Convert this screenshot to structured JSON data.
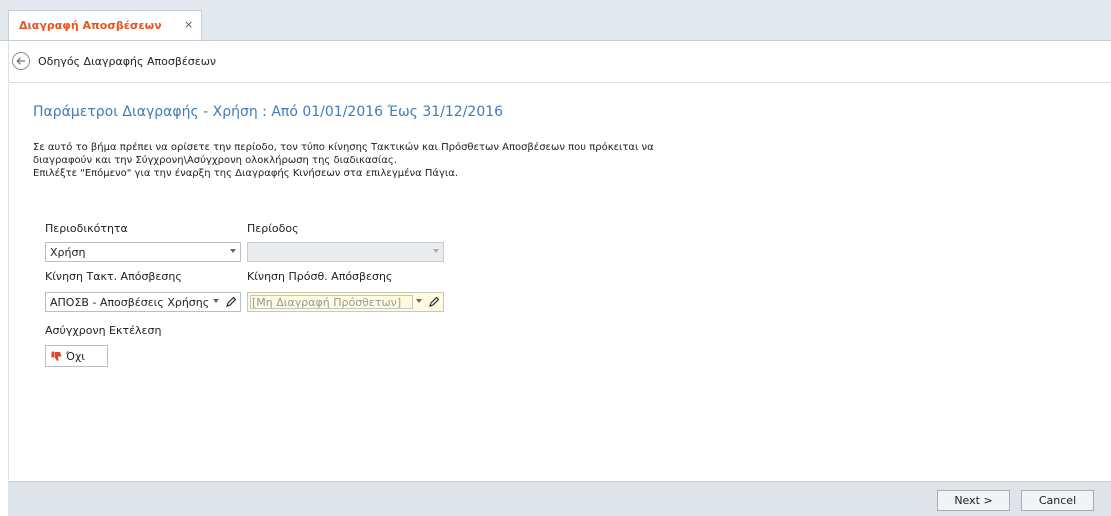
{
  "tab": {
    "label": "Διαγραφή Αποσβέσεων",
    "close": "×"
  },
  "wizard": {
    "title": "Οδηγός Διαγραφής Αποσβέσεων"
  },
  "page": {
    "title": "Παράμετροι Διαγραφής - Χρήση : Από 01/01/2016 Έως 31/12/2016",
    "description": [
      "Σε αυτό το βήμα πρέπει να ορίσετε την περίοδο, τον τύπο κίνησης Τακτικών και Πρόσθετων Αποσβέσεων που πρόκειται να",
      "διαγραφούν και την Σύγχρονη\\Ασύγχρονη ολοκλήρωση της διαδικασίας.",
      "Επιλέξτε \"Επόμενο\" για την έναρξη της Διαγραφής Κινήσεων στα επιλεγμένα Πάγια."
    ]
  },
  "form": {
    "periodicity": {
      "label": "Περιοδικότητα",
      "value": "Χρήση"
    },
    "period": {
      "label": "Περίοδος",
      "value": ""
    },
    "regular_movement": {
      "label": "Κίνηση Τακτ. Απόσβεσης",
      "value": "ΑΠΟΣΒ - Αποσβέσεις Χρήσης"
    },
    "additional_movement": {
      "label": "Κίνηση Πρόσθ. Απόσβεσης",
      "value": "[Μη Διαγραφή Πρόσθετων]"
    },
    "async": {
      "label": "Ασύγχρονη Εκτέλεση",
      "value": "Όχι"
    }
  },
  "footer": {
    "next": "Next >",
    "cancel": "Cancel"
  },
  "colors": {
    "accent_tab": "#e8541d",
    "title_blue": "#3f7cb8",
    "yellow_field": "#fffbe0"
  }
}
